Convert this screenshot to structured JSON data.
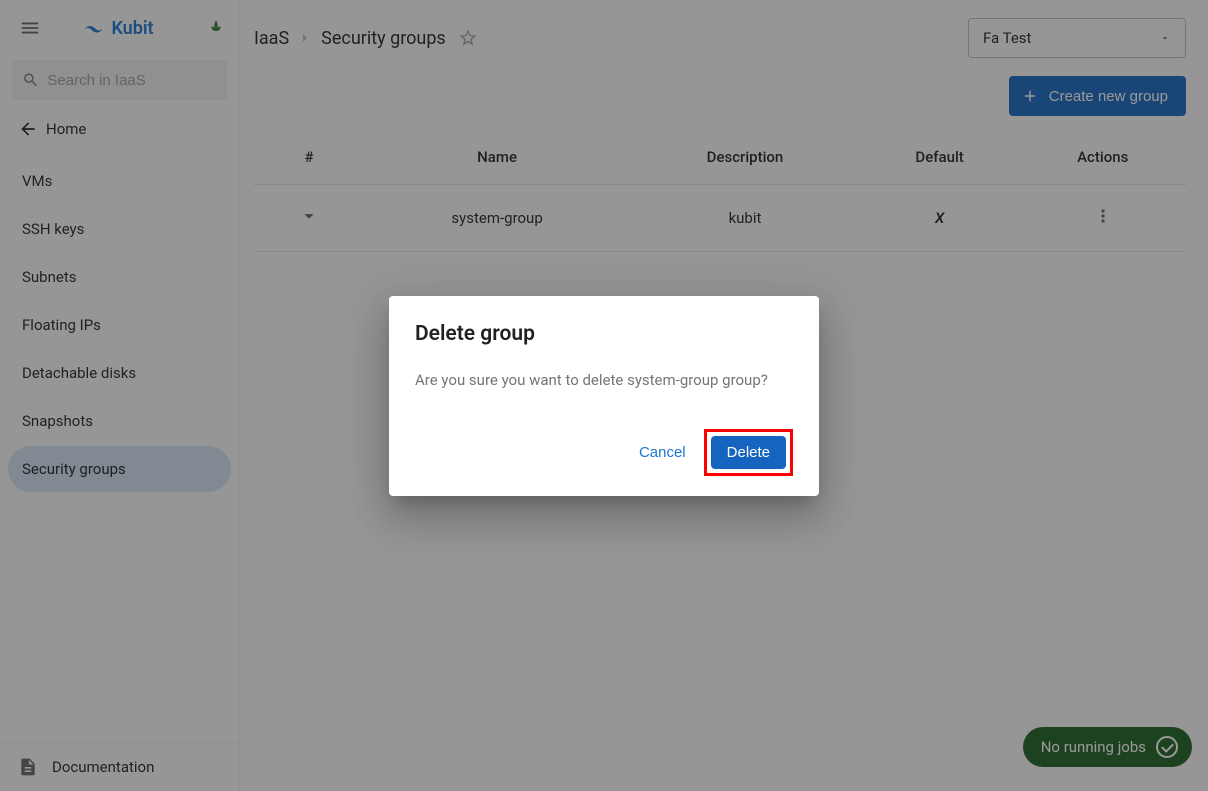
{
  "header": {
    "brand": "Kubit"
  },
  "search": {
    "placeholder": "Search in IaaS"
  },
  "home": {
    "label": "Home"
  },
  "nav": [
    {
      "label": "VMs",
      "active": false
    },
    {
      "label": "SSH keys",
      "active": false
    },
    {
      "label": "Subnets",
      "active": false
    },
    {
      "label": "Floating IPs",
      "active": false
    },
    {
      "label": "Detachable disks",
      "active": false
    },
    {
      "label": "Snapshots",
      "active": false
    },
    {
      "label": "Security groups",
      "active": true
    }
  ],
  "documentation": {
    "label": "Documentation"
  },
  "breadcrumb": {
    "parent": "IaaS",
    "current": "Security groups"
  },
  "project_select": {
    "value": "Fa Test"
  },
  "create_button": {
    "label": "Create new group"
  },
  "table": {
    "headers": {
      "idx": "#",
      "name": "Name",
      "desc": "Description",
      "def": "Default",
      "actions": "Actions"
    },
    "rows": [
      {
        "name": "system-group",
        "desc": "kubit",
        "def": "X"
      }
    ]
  },
  "dialog": {
    "title": "Delete group",
    "body": "Are you sure you want to delete system-group group?",
    "cancel": "Cancel",
    "confirm": "Delete"
  },
  "jobs": {
    "label": "No running jobs"
  }
}
